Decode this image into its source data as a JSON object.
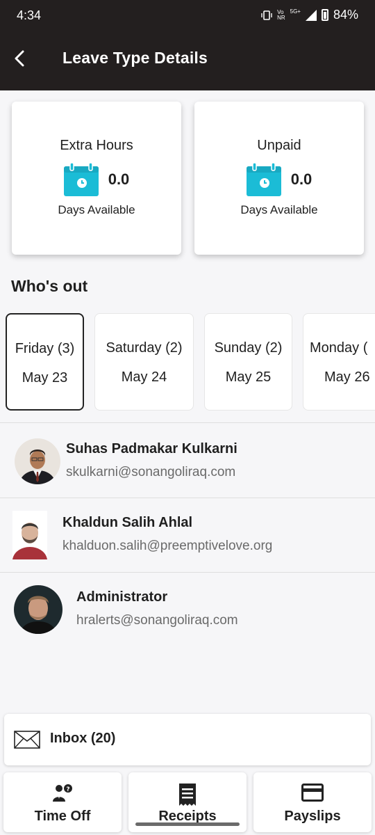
{
  "status_bar": {
    "time": "4:34",
    "network_top": "Vo",
    "network_bottom": "NR",
    "signal": "5G+",
    "battery": "84%"
  },
  "header": {
    "title": "Leave Type Details"
  },
  "leave_cards": [
    {
      "title": "Extra Hours",
      "value": "0.0",
      "subtitle": "Days Available"
    },
    {
      "title": "Unpaid",
      "value": "0.0",
      "subtitle": "Days Available"
    }
  ],
  "whos_out": {
    "title": "Who's out"
  },
  "days": [
    {
      "day": "Friday (3)",
      "date": "May 23",
      "selected": true
    },
    {
      "day": "Saturday (2)",
      "date": "May 24",
      "selected": false
    },
    {
      "day": "Sunday (2)",
      "date": "May 25",
      "selected": false
    },
    {
      "day": "Monday (",
      "date": "May 26",
      "selected": false
    }
  ],
  "people": [
    {
      "name": "Suhas Padmakar Kulkarni",
      "email": "skulkarni@sonangoliraq.com"
    },
    {
      "name": "Khaldun Salih Ahlal",
      "email": "khalduon.salih@preemptivelove.org"
    },
    {
      "name": "Administrator",
      "email": "hralerts@sonangoliraq.com"
    }
  ],
  "inbox": {
    "label": "Inbox (20)"
  },
  "bottom_nav": [
    {
      "label": "Time Off",
      "icon": "time-off-icon"
    },
    {
      "label": "Receipts",
      "icon": "receipt-icon"
    },
    {
      "label": "Payslips",
      "icon": "card-icon"
    }
  ],
  "colors": {
    "header_bg": "#231f1f",
    "calendar_icon": "#1bbcd6"
  }
}
